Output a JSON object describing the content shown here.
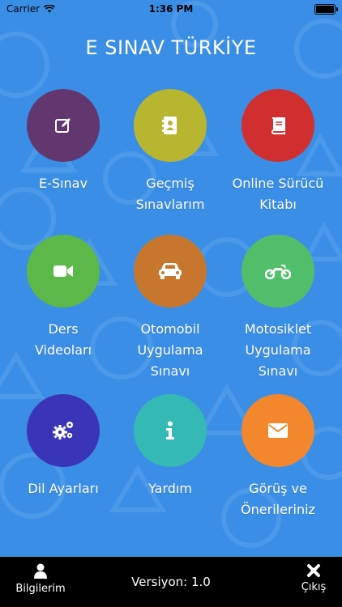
{
  "status_bar": {
    "carrier": "Carrier",
    "time": "1:36 PM"
  },
  "header": {
    "title": "E SINAV TÜRKİYE"
  },
  "menu": [
    {
      "lines": [
        "E-Sınav"
      ],
      "color": "#62366f",
      "icon": "edit-icon"
    },
    {
      "lines": [
        "Geçmiş",
        "Sınavlarım"
      ],
      "color": "#b8b631",
      "icon": "address-book-icon"
    },
    {
      "lines": [
        "Online Sürücü",
        "Kitabı"
      ],
      "color": "#d12f2f",
      "icon": "book-icon"
    },
    {
      "lines": [
        "Ders",
        "Videoları"
      ],
      "color": "#5cb848",
      "icon": "video-camera-icon"
    },
    {
      "lines": [
        "Otomobil",
        "Uygulama",
        "Sınavı"
      ],
      "color": "#c7772d",
      "icon": "car-icon"
    },
    {
      "lines": [
        "Motosiklet",
        "Uygulama",
        "Sınavı"
      ],
      "color": "#51bf6a",
      "icon": "motorcycle-icon"
    },
    {
      "lines": [
        "Dil Ayarları"
      ],
      "color": "#3a35b8",
      "icon": "gears-icon"
    },
    {
      "lines": [
        "Yardım"
      ],
      "color": "#35b9b4",
      "icon": "info-icon"
    },
    {
      "lines": [
        "Görüş ve",
        "Önerileriniz"
      ],
      "color": "#f2872d",
      "icon": "envelope-icon"
    }
  ],
  "bottom_bar": {
    "profile_label": "Bilgilerim",
    "version": "Versiyon: 1.0",
    "exit_label": "Çıkış"
  }
}
